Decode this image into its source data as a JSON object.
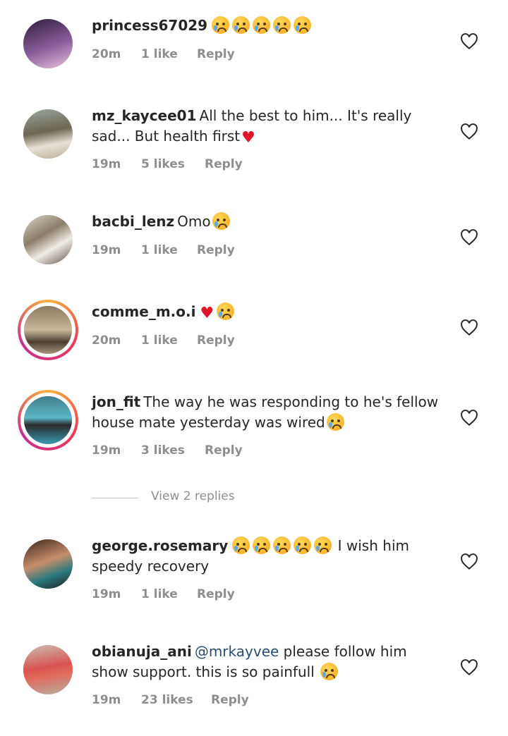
{
  "comments": [
    {
      "username": "princess67029",
      "text": "",
      "emoji_after": 5,
      "time": "20m",
      "likes": "1 like",
      "reply": "Reply"
    },
    {
      "username": "mz_kaycee01",
      "text": "All the best to him... It's really sad... But health first",
      "heart": true,
      "time": "19m",
      "likes": "5 likes",
      "reply": "Reply"
    },
    {
      "username": "bacbi_lenz",
      "text": "Omo",
      "emoji_after": 1,
      "time": "19m",
      "likes": "1 like",
      "reply": "Reply"
    },
    {
      "username": "comme_m.o.i",
      "text": "",
      "heart": true,
      "emoji_after": 1,
      "time": "20m",
      "likes": "1 like",
      "reply": "Reply"
    },
    {
      "username": "jon_fit",
      "text": "The way he was responding to he's fellow house mate yesterday was wired",
      "emoji_after": 1,
      "time": "19m",
      "likes": "3 likes",
      "reply": "Reply"
    },
    {
      "username": "george.rosemary",
      "text": "I wish him speedy recovery",
      "emoji_before": 5,
      "time": "19m",
      "likes": "1 like",
      "reply": "Reply"
    },
    {
      "username": "obianuja_ani",
      "mention": "@mrkayvee",
      "text": "please follow him show support. this is so painfull",
      "emoji_after": 1,
      "time": "19m",
      "likes": "23 likes",
      "reply": "Reply"
    }
  ],
  "view_replies": "View 2 replies",
  "icons": {
    "like": "heart-outline-icon",
    "emoji": "crying-face-emoji",
    "heart": "red-heart-emoji"
  },
  "colors": {
    "username": "#262626",
    "meta": "#8e8e8e",
    "mention": "#2a4d73",
    "heart": "#e0152b"
  }
}
